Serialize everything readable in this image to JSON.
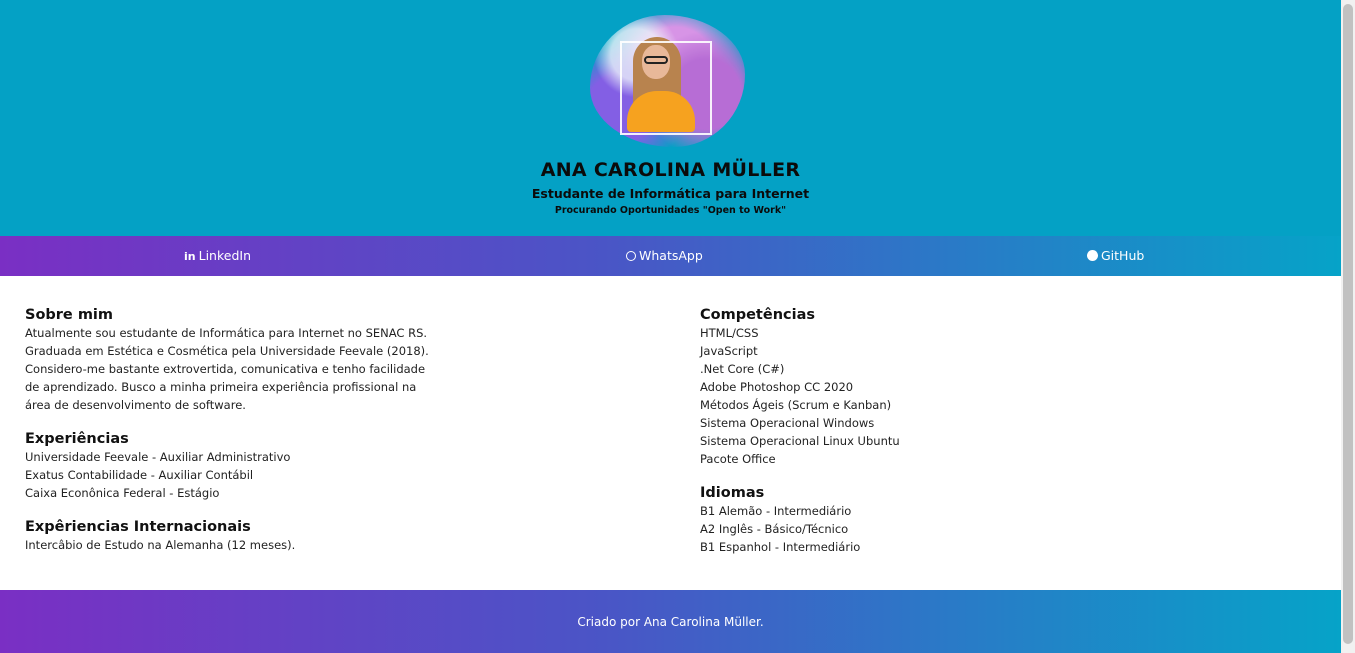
{
  "header": {
    "name": "ANA CAROLINA MÜLLER",
    "subtitle": "Estudante de Informática para Internet",
    "tagline": "Procurando Oportunidades \"Open to Work\""
  },
  "nav": {
    "links": [
      {
        "label": "LinkedIn",
        "icon": "linkedin-icon"
      },
      {
        "label": "WhatsApp",
        "icon": "whatsapp-icon"
      },
      {
        "label": "GitHub",
        "icon": "github-icon"
      }
    ]
  },
  "sections": {
    "about": {
      "title": "Sobre mim",
      "lines": [
        "Atualmente sou estudante de Informática para Internet no SENAC RS.",
        "Graduada em Estética e Cosmética pela Universidade Feevale (2018).",
        "Considero-me bastante extrovertida, comunicativa e tenho facilidade",
        "de aprendizado. Busco a minha primeira experiência profissional na",
        "área de desenvolvimento de software."
      ]
    },
    "experience": {
      "title": "Experiências",
      "items": [
        "Universidade Feevale - Auxiliar Administrativo",
        "Exatus Contabilidade - Auxiliar Contábil",
        "Caixa Econônica Federal - Estágio"
      ]
    },
    "international": {
      "title": "Expêriencias Internacionais",
      "items": [
        "Intercâbio de Estudo na Alemanha (12 meses)."
      ]
    },
    "skills": {
      "title": "Competências",
      "items": [
        "HTML/CSS",
        "JavaScript",
        ".Net Core (C#)",
        "Adobe Photoshop CC 2020",
        "Métodos Ágeis (Scrum e Kanban)",
        "Sistema Operacional Windows",
        "Sistema Operacional Linux Ubuntu",
        "Pacote Office"
      ]
    },
    "languages": {
      "title": "Idiomas",
      "items": [
        "B1 Alemão - Intermediário",
        "A2 Inglês - Básico/Técnico",
        "B1 Espanhol - Intermediário"
      ]
    }
  },
  "footer": {
    "text": "Criado por Ana Carolina Müller."
  },
  "colors": {
    "header_bg": "#04a1c5",
    "gradient_start": "#7a2fc4",
    "gradient_end": "#06a3c8"
  }
}
